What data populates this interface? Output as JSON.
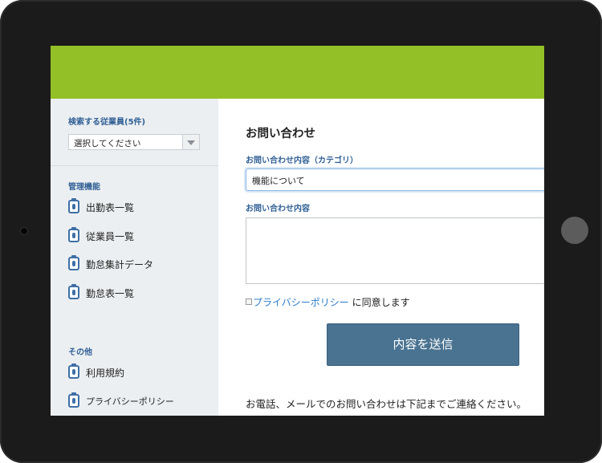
{
  "sidebar": {
    "search_heading": "検索する従業員(5件)",
    "select_value": "選択してください",
    "admin_heading": "管理機能",
    "admin_items": [
      {
        "label": "出勤表一覧"
      },
      {
        "label": "従業員一覧"
      },
      {
        "label": "勤怠集計データ"
      },
      {
        "label": "勤怠表一覧"
      }
    ],
    "other_heading": "その他",
    "other_items": [
      {
        "label": "利用規約"
      },
      {
        "label": "プライバシーポリシー"
      }
    ]
  },
  "main": {
    "title": "お問い合わせ",
    "category_label": "お問い合わせ内容（カテゴリ）",
    "category_value": "機能について",
    "content_label": "お問い合わせ内容",
    "content_value": "",
    "privacy_link": "プライバシーポリシー",
    "consent_text": " に同意します",
    "submit_label": "内容を送信",
    "footer_note": "お電話、メールでのお問い合わせは下記までご連絡ください。"
  },
  "colors": {
    "header": "#93c026",
    "sidebar_bg": "#eceff1",
    "heading_blue": "#2f5f95",
    "link_blue": "#2c7cc9",
    "button": "#4a7391"
  }
}
